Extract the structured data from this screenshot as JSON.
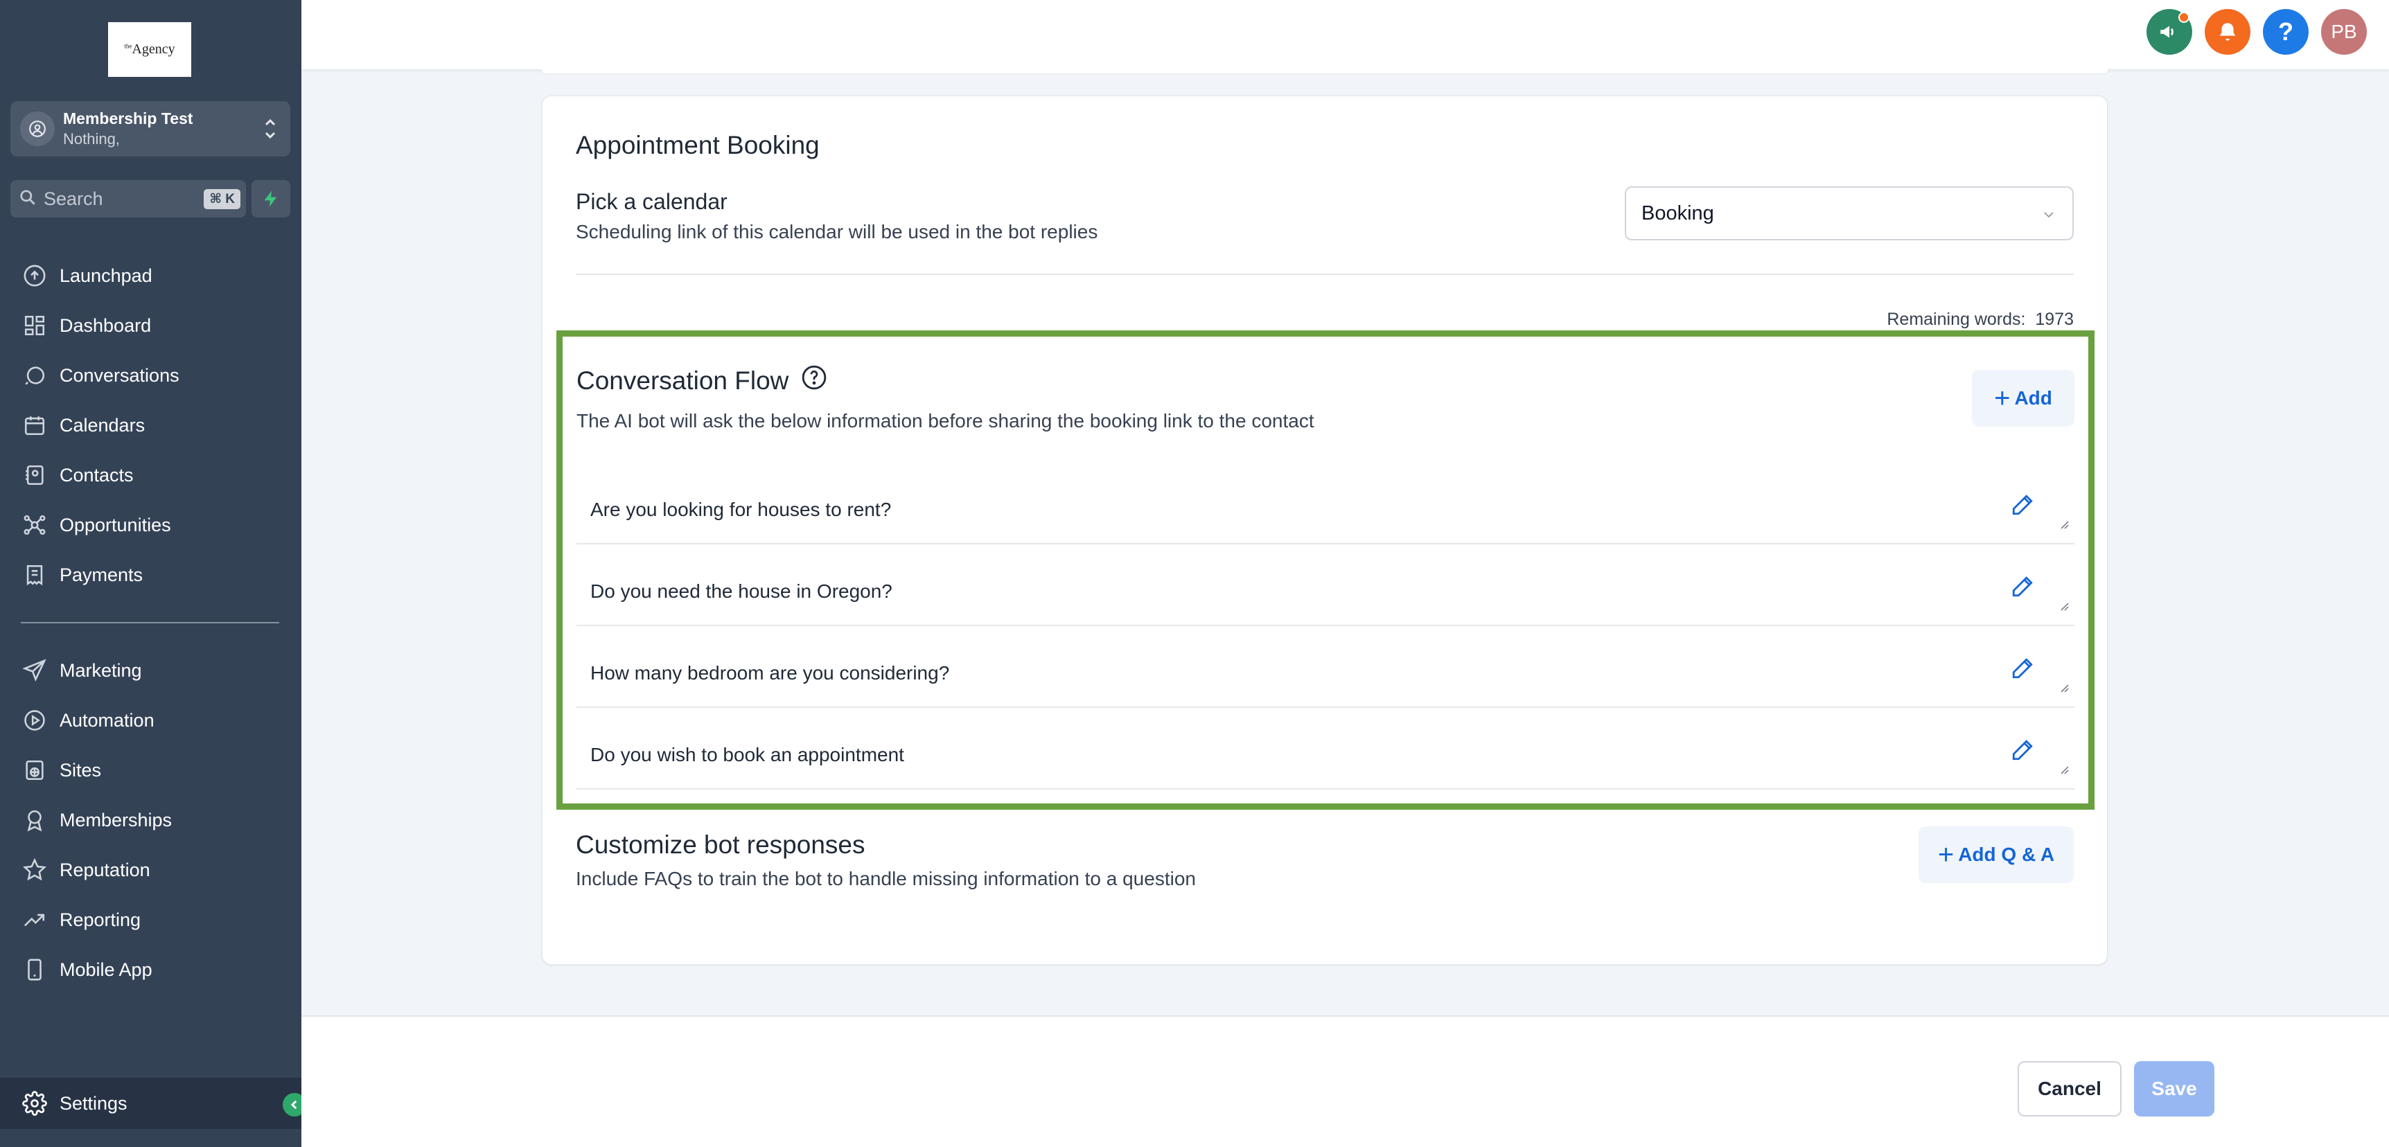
{
  "logo": {
    "text": "Agency",
    "prefix": "the"
  },
  "account": {
    "name": "Membership Test",
    "subtitle": "Nothing,"
  },
  "search": {
    "placeholder": "Search",
    "shortcut": "⌘ K"
  },
  "sidebar": {
    "items": [
      {
        "label": "Launchpad",
        "icon": "rocket-icon"
      },
      {
        "label": "Dashboard",
        "icon": "grid-icon"
      },
      {
        "label": "Conversations",
        "icon": "chat-icon"
      },
      {
        "label": "Calendars",
        "icon": "calendar-icon"
      },
      {
        "label": "Contacts",
        "icon": "contacts-icon"
      },
      {
        "label": "Opportunities",
        "icon": "network-icon"
      },
      {
        "label": "Payments",
        "icon": "receipt-icon"
      },
      {
        "label": "Marketing",
        "icon": "send-icon"
      },
      {
        "label": "Automation",
        "icon": "play-circle-icon"
      },
      {
        "label": "Sites",
        "icon": "globe-icon"
      },
      {
        "label": "Memberships",
        "icon": "award-icon"
      },
      {
        "label": "Reputation",
        "icon": "star-icon"
      },
      {
        "label": "Reporting",
        "icon": "trend-icon"
      },
      {
        "label": "Mobile App",
        "icon": "phone-icon"
      }
    ],
    "settings_label": "Settings"
  },
  "topbar": {
    "avatar_initials": "PB"
  },
  "colors": {
    "sidebar": "#344256",
    "accent": "#1565d8",
    "highlight": "#6aa03f",
    "announce": "#2d8a66",
    "bell": "#f46a1f",
    "help": "#1e7be6"
  },
  "booking": {
    "section_title": "Appointment Booking",
    "pick_label": "Pick a calendar",
    "pick_desc": "Scheduling link of this calendar will be used in the bot replies",
    "calendar_value": "Booking"
  },
  "remaining": {
    "label": "Remaining words:",
    "count": "1973"
  },
  "flow": {
    "title": "Conversation Flow",
    "desc": "The AI bot will ask the below information before sharing the booking link to the contact",
    "add_label": "Add",
    "questions": [
      "Are you looking for houses to rent?",
      "Do you need the house in Oregon?",
      "How many bedroom are you considering?",
      "Do you wish to book an appointment"
    ]
  },
  "custom": {
    "title": "Customize bot responses",
    "desc": "Include FAQs to train the bot to handle missing information to a question",
    "add_label": "Add Q & A"
  },
  "footer": {
    "cancel_label": "Cancel",
    "save_label": "Save"
  }
}
